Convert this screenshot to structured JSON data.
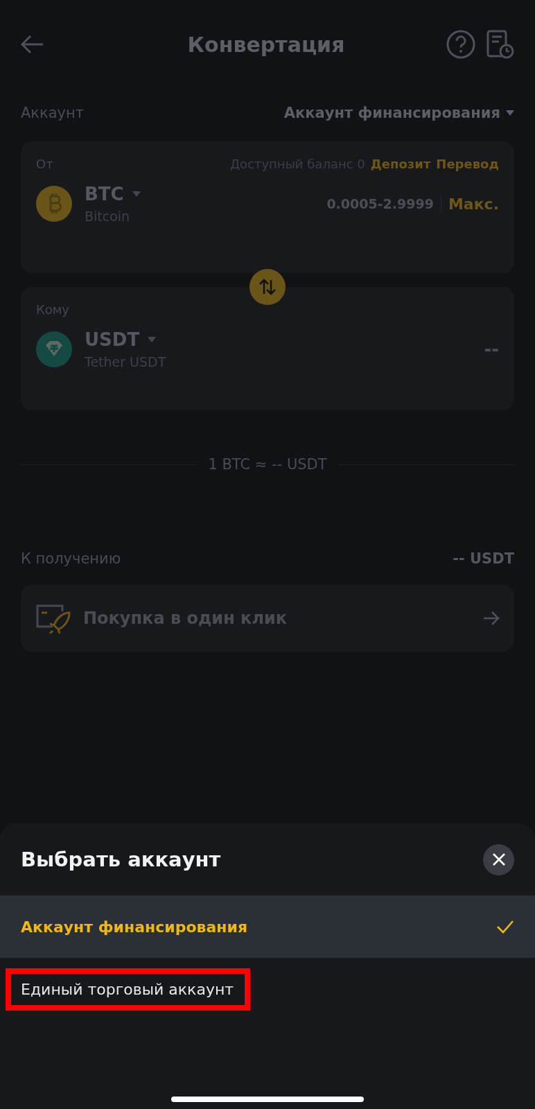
{
  "header": {
    "title": "Конвертация"
  },
  "account": {
    "label": "Аккаунт",
    "value": "Аккаунт финансирования"
  },
  "from": {
    "label": "От",
    "balance": "Доступный баланс 0",
    "links": [
      "Депозит",
      "Перевод"
    ],
    "coin": {
      "kind": "btc",
      "symbol": "BTC",
      "name": "Bitcoin"
    },
    "range": "0.0005-2.9999",
    "max": "Макс."
  },
  "to": {
    "label": "Кому",
    "coin": {
      "kind": "usdt",
      "symbol": "USDT",
      "name": "Tether USDT"
    },
    "amount": "--"
  },
  "rate": "1 BTC ≈ -- USDT",
  "receive": {
    "label": "К получению",
    "value": "-- USDT"
  },
  "quick_buy": {
    "label": "Покупка в один клик"
  },
  "sheet": {
    "title": "Выбрать аккаунт",
    "options": [
      {
        "label": "Аккаунт финансирования",
        "selected": true,
        "highlighted": false
      },
      {
        "label": "Единый торговый аккаунт",
        "selected": false,
        "highlighted": true
      }
    ]
  }
}
